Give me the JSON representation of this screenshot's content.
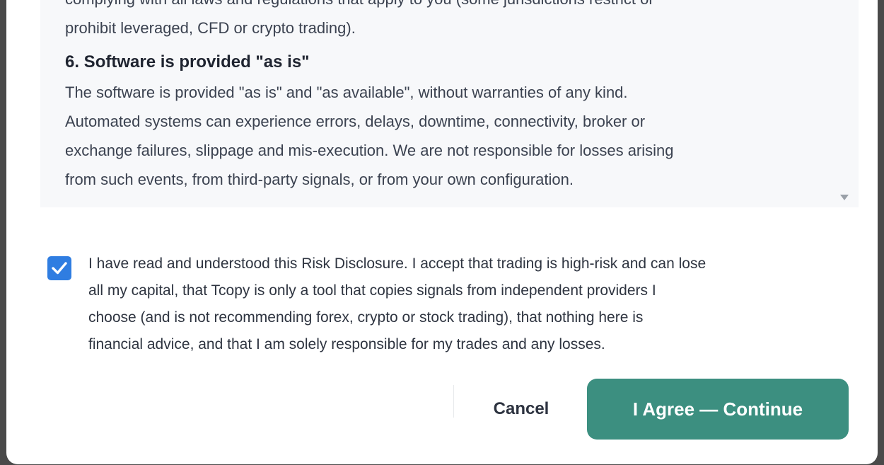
{
  "disclosure": {
    "intro_lines": [
      "complying with all laws and regulations that apply to you (some jurisdictions restrict or",
      "prohibit leveraged, CFD or crypto trading)."
    ],
    "section6_heading": "6. Software is provided \"as is\"",
    "section6_lines": [
      "The software is provided \"as is\" and \"as available\", without warranties of any kind.",
      "Automated systems can experience errors, delays, downtime, connectivity, broker or",
      "exchange failures, slippage and mis-execution. We are not responsible for losses arising",
      "from such events, from third-party signals, or from your own configuration."
    ]
  },
  "consent": {
    "checked": true,
    "lines": [
      "I have read and understood this Risk Disclosure. I accept that trading is high-risk and can lose",
      "all my capital, that Tcopy is only a tool that copies signals from independent providers I",
      "choose (and is not recommending forex, crypto or stock trading), that nothing here is",
      "financial advice, and that I am solely responsible for my trades and any losses."
    ]
  },
  "actions": {
    "cancel_label": "Cancel",
    "agree_label": "I Agree — Continue"
  },
  "colors": {
    "checkbox": "#2f7de1",
    "agree_button": "#3c8f80"
  },
  "icons": {
    "checkbox": "checkmark-icon",
    "scroll": "scroll-down-arrow-icon"
  }
}
